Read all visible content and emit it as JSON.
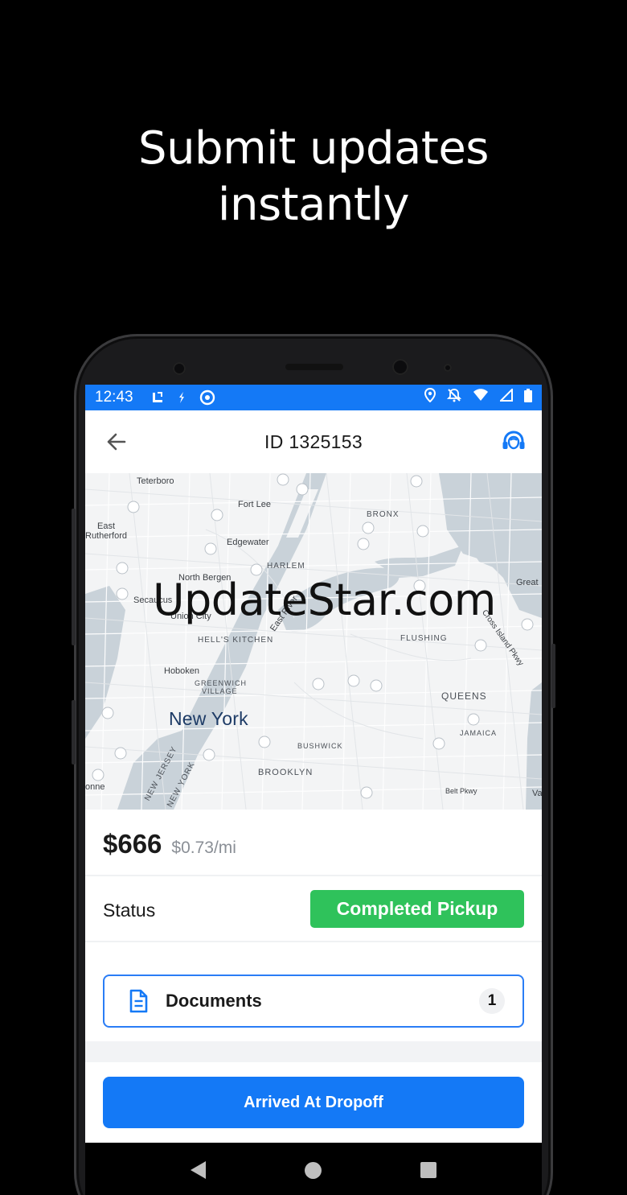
{
  "promo": {
    "headline_line1": "Submit updates",
    "headline_line2": "instantly"
  },
  "statusbar": {
    "time": "12:43",
    "left_icons": [
      "pinned-app-icon",
      "transfer-icon",
      "at-sign-icon"
    ],
    "right_icons": [
      "location-icon",
      "notifications-off-icon",
      "wifi-icon",
      "signal-icon",
      "battery-icon"
    ]
  },
  "appbar": {
    "title": "ID 1325153",
    "back_icon": "arrow-left-icon",
    "support_icon": "headset-icon"
  },
  "map": {
    "labels": {
      "teterboro": "Teterboro",
      "fort_lee": "Fort Lee",
      "east_rutherford_1": "East",
      "east_rutherford_2": "Rutherford",
      "edgewater": "Edgewater",
      "bronx": "BRONX",
      "harlem": "HARLEM",
      "north_bergen": "North Bergen",
      "secaucus": "Secaucus",
      "union_city": "Union City",
      "east_river": "East River",
      "great": "Great",
      "hells_kitchen": "HELL'S KITCHEN",
      "flushing": "FLUSHING",
      "cross_island_pkwy": "Cross Island Pkwy",
      "hoboken": "Hoboken",
      "greenwich_1": "GREENWICH",
      "greenwich_2": "VILLAGE",
      "queens": "QUEENS",
      "new_york": "New York",
      "jamaica": "JAMAICA",
      "bushwick": "BUSHWICK",
      "new_jersey": "NEW JERSEY",
      "new_york_state": "NEW YORK",
      "brooklyn": "BROOKLYN",
      "belt_pkwy": "Belt Pkwy",
      "onne": "onne",
      "va": "Va"
    },
    "watermark": "UpdateStar.com"
  },
  "load": {
    "price": "$666",
    "rate": "$0.73/mi",
    "status_label": "Status",
    "status_value": "Completed Pickup",
    "documents_label": "Documents",
    "documents_count": "1",
    "documents_icon": "document-icon"
  },
  "actions": {
    "primary_label": "Arrived At Dropoff"
  },
  "colors": {
    "accent": "#1479f6",
    "status_green": "#2fc25b",
    "water": "#c9d2d9",
    "map_bg": "#f3f4f5"
  },
  "navbar": {
    "icons": [
      "back-triangle-icon",
      "home-circle-icon",
      "recents-square-icon"
    ]
  }
}
